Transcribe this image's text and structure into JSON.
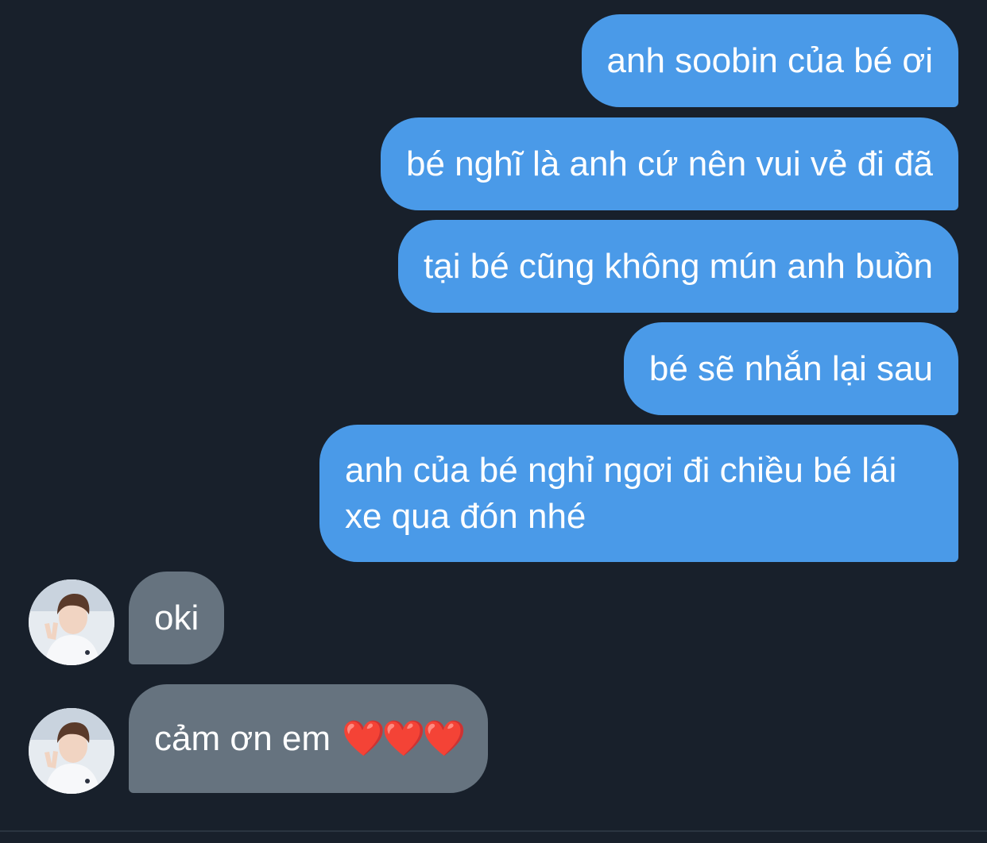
{
  "colors": {
    "background": "#18202b",
    "outgoing_bubble": "#4a9ae8",
    "incoming_bubble": "#66737f",
    "text": "#ffffff",
    "heart": "#e0242f"
  },
  "messages": {
    "outgoing": [
      {
        "text": "anh soobin của bé ơi"
      },
      {
        "text": "bé nghĩ là anh cứ nên vui vẻ đi đã"
      },
      {
        "text": "tại bé cũng không mún anh buồn"
      },
      {
        "text": "bé sẽ nhắn lại sau"
      },
      {
        "text": "anh của bé nghỉ ngơi đi chiều bé lái xe qua đón nhé"
      }
    ],
    "incoming": [
      {
        "text": "oki",
        "avatar": "profile-photo"
      },
      {
        "text": "cảm ơn em",
        "emoji": "❤️❤️❤️",
        "avatar": "profile-photo"
      }
    ]
  }
}
